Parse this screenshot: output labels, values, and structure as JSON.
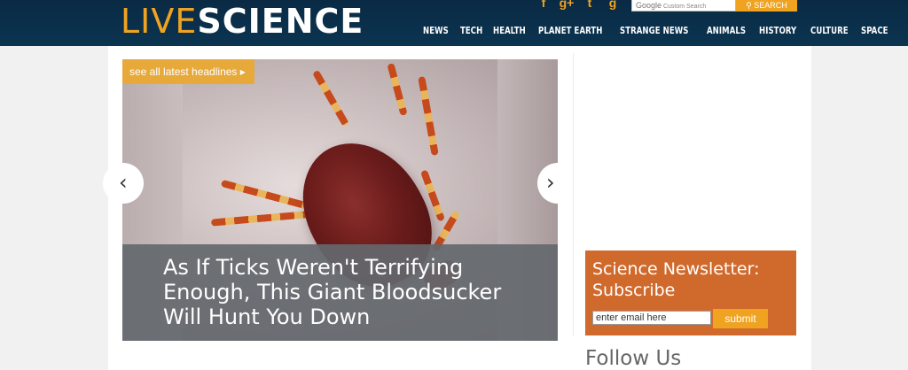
{
  "header": {
    "logo": {
      "part1": "LIVE",
      "part2": "SCIENCE"
    },
    "social": [
      "f",
      "g+",
      "t",
      "g"
    ],
    "search": {
      "google_label": "Google",
      "placeholder": "Custom Search",
      "button_label": "SEARCH"
    },
    "nav": [
      "NEWS",
      "TECH",
      "HEALTH",
      "PLANET EARTH",
      "STRANGE NEWS",
      "ANIMALS",
      "HISTORY",
      "CULTURE",
      "SPACE"
    ]
  },
  "slider": {
    "headlines_label": "see all latest headlines ▸",
    "prev_arrow": "‹",
    "next_arrow": "›",
    "caption": "As If Ticks Weren't Terrifying Enough, This Giant Bloodsucker Will Hunt You Down"
  },
  "newsletter": {
    "title": "Science Newsletter: Subscribe",
    "email_placeholder": "enter email here",
    "submit_label": "submit"
  },
  "follow": {
    "title": "Follow Us"
  },
  "colors": {
    "header_bg": "#0b3450",
    "accent": "#f0a321",
    "newsletter_bg": "#d06a2c",
    "caption_bg": "#64686e"
  }
}
